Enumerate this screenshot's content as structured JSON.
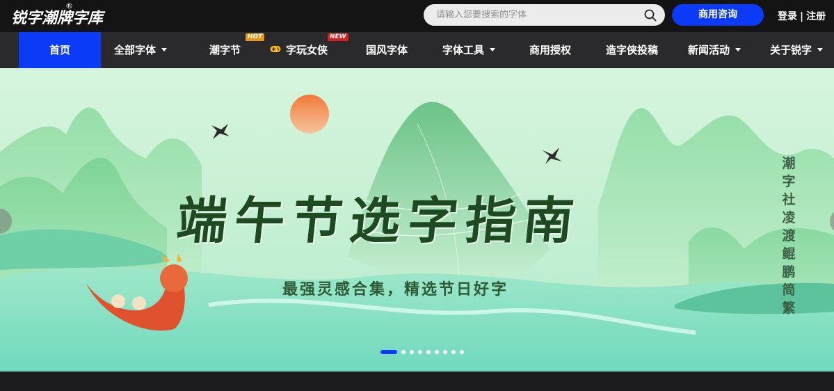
{
  "header": {
    "logo_text": "锐字潮牌字库",
    "logo_mark": "®",
    "search_placeholder": "请输入您要搜索的字体",
    "consult_label": "商用咨询",
    "login_label": "登录",
    "auth_separator": "|",
    "register_label": "注册"
  },
  "nav": {
    "items": [
      {
        "label": "首页",
        "active": true
      },
      {
        "label": "全部字体",
        "dropdown": true
      },
      {
        "label": "潮字节",
        "badge": "HOT"
      },
      {
        "label": "字玩女侠",
        "badge": "NEW",
        "icon": "gamepad-icon"
      },
      {
        "label": "国风字体"
      },
      {
        "label": "字体工具",
        "dropdown": true
      },
      {
        "label": "商用授权"
      },
      {
        "label": "造字侠投稿"
      },
      {
        "label": "新闻活动",
        "dropdown": true
      },
      {
        "label": "关于锐字",
        "dropdown": true
      }
    ]
  },
  "banner": {
    "title": "端午节选字指南",
    "subtitle": "最强灵感合集，精选节日好字",
    "vertical_text": "潮字社凌渡鲲鹏简繁",
    "slide_count": 9,
    "active_slide": 1
  },
  "colors": {
    "accent": "#0b3bf6",
    "topbar": "#141414",
    "nav": "#2a2a2c",
    "hot": "#e8961a",
    "new": "#d92020",
    "title_green": "#1e4a22"
  }
}
